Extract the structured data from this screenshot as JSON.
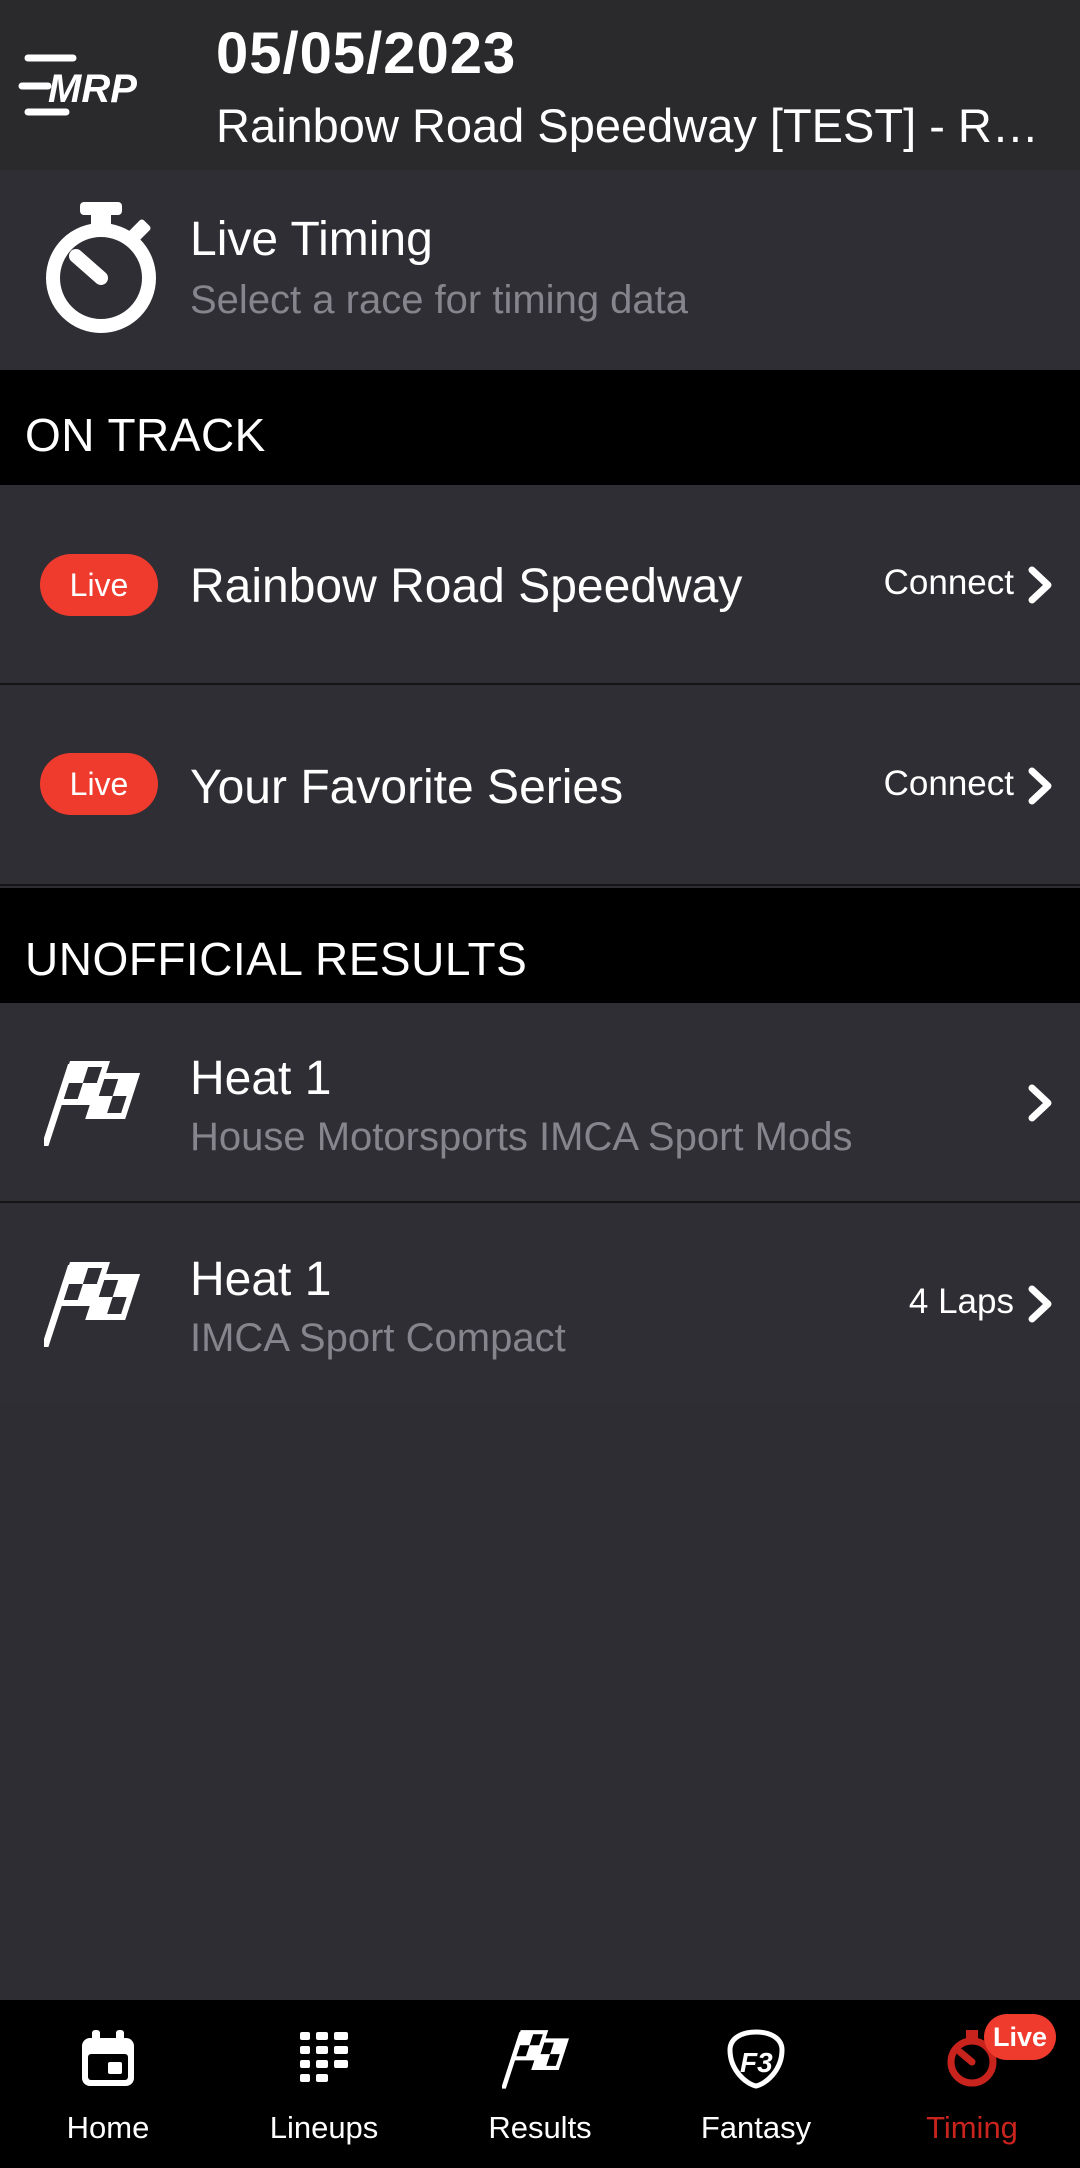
{
  "header": {
    "date": "05/05/2023",
    "subtitle": "Rainbow Road Speedway [TEST] - Re...",
    "logo_icon": "mrp-menu-logo-icon"
  },
  "live_timing": {
    "title": "Live Timing",
    "subtitle": "Select a race for timing data",
    "icon": "stopwatch-icon"
  },
  "on_track": {
    "heading": "ON TRACK",
    "items": [
      {
        "badge": "Live",
        "name": "Rainbow Road Speedway",
        "action": "Connect"
      },
      {
        "badge": "Live",
        "name": "Your Favorite Series",
        "action": "Connect"
      }
    ]
  },
  "unofficial_results": {
    "heading": "UNOFFICIAL RESULTS",
    "items": [
      {
        "title": "Heat 1",
        "subtitle": "House Motorsports IMCA Sport Mods",
        "meta": ""
      },
      {
        "title": "Heat 1",
        "subtitle": "IMCA Sport Compact",
        "meta": "4 Laps"
      }
    ]
  },
  "tabbar": {
    "items": [
      {
        "label": "Home",
        "icon": "calendar-icon"
      },
      {
        "label": "Lineups",
        "icon": "lineups-list-icon"
      },
      {
        "label": "Results",
        "icon": "checkered-flag-icon"
      },
      {
        "label": "Fantasy",
        "icon": "fantasy-shield-icon"
      },
      {
        "label": "Timing",
        "icon": "stopwatch-icon",
        "badge": "Live"
      }
    ],
    "active_color": "#c8231d"
  },
  "colors": {
    "background": "#2e2d33",
    "row_background": "#2f2e34",
    "section_header": "#000000",
    "live_badge": "#ef3b2e",
    "secondary_text": "#86858d"
  }
}
